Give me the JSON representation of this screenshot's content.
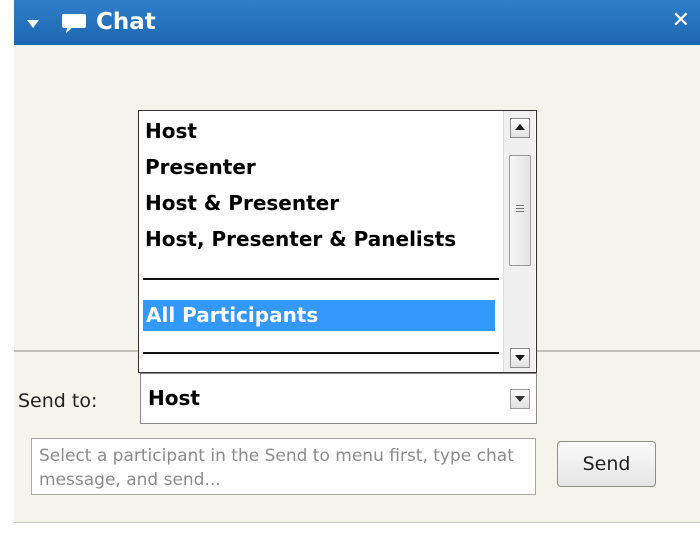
{
  "panel": {
    "title": "Chat",
    "icons": {
      "collapse": "triangle-down-icon",
      "chat": "chat-bubble-icon",
      "close": "close-icon"
    },
    "close_glyph": "✕"
  },
  "dropdown": {
    "items": [
      {
        "label": "Host"
      },
      {
        "label": "Presenter"
      },
      {
        "label": "Host & Presenter"
      },
      {
        "label": "Host, Presenter & Panelists"
      },
      {
        "label": "All Participants",
        "highlighted": true
      }
    ]
  },
  "send_to": {
    "label": "Send to:",
    "selected": "Host"
  },
  "composer": {
    "placeholder": "Select a participant in the Send to menu first, type chat message, and send...",
    "send_label": "Send"
  },
  "colors": {
    "titlebar": "#1e67b2",
    "highlight": "#3399ff",
    "panel_bg": "#f5f4ec"
  }
}
